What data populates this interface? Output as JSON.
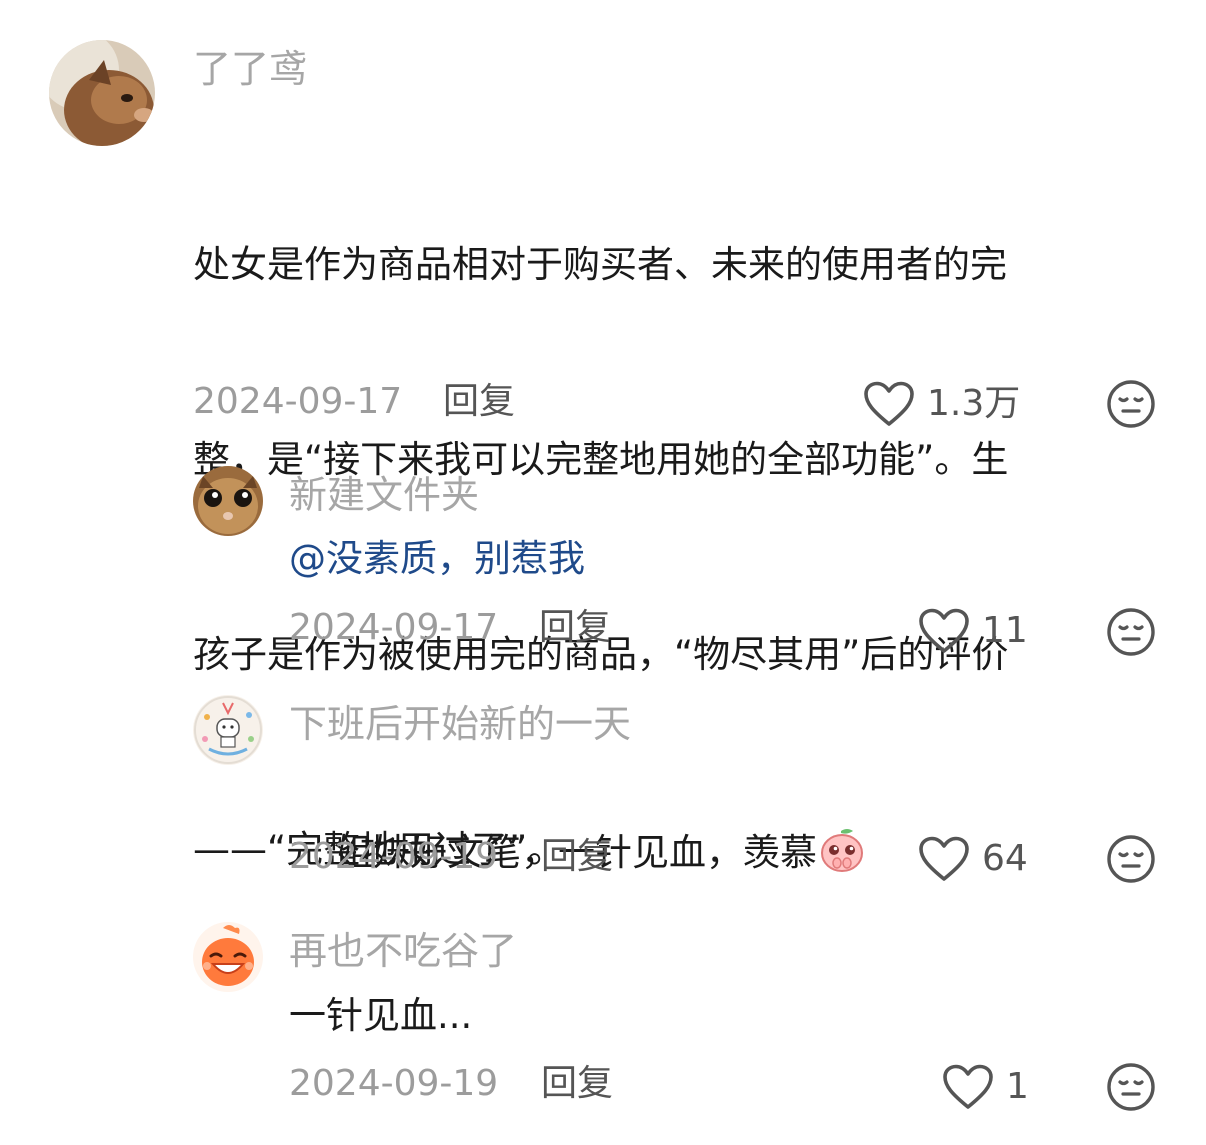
{
  "comments": [
    {
      "username": "了了鸢",
      "lines": [
        "处女是作为商品相对于购买者、未来的使用者的完",
        "整，是“接下来我可以完整地用她的全部功能”。生",
        "孩子是作为被使用完的商品，“物尽其用”后的评价",
        "——“完整地用过了”。"
      ],
      "date": "2024-09-17",
      "reply_label": "回复",
      "likes": "1.3万",
      "avatar_icon": "cat-avatar-icon"
    },
    {
      "username": "新建文件夹",
      "text": "@没素质，别惹我",
      "date": "2024-09-17",
      "reply_label": "回复",
      "likes": "11",
      "avatar_icon": "kitten-face-avatar-icon"
    },
    {
      "username": "下班后开始新的一天",
      "text": "姐妹好文笔，一针见血，羡慕",
      "emoji": "peach-pleading-emoji",
      "date": "2024-09-19",
      "reply_label": "回复",
      "likes": "64",
      "avatar_icon": "happy-bear-avatar-icon"
    },
    {
      "username": "再也不吃谷了",
      "text": "一针见血...",
      "date": "2024-09-19",
      "reply_label": "回复",
      "likes": "1",
      "avatar_icon": "laughing-face-avatar-icon"
    }
  ],
  "colors": {
    "username": "#a6a6a6",
    "mention": "#1f4a8a",
    "body": "#1a1a1a",
    "meta": "#9c9c9c"
  }
}
